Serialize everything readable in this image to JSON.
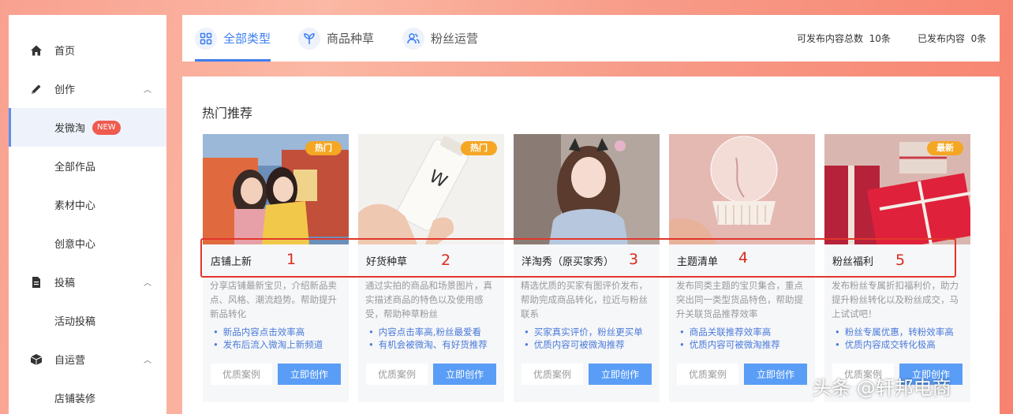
{
  "sidebar": {
    "items": [
      {
        "label": "首页",
        "icon": "home-icon"
      },
      {
        "label": "创作",
        "icon": "pencil-icon",
        "chevron": "up"
      },
      {
        "label": "发微淘",
        "badge": "NEW"
      },
      {
        "label": "全部作品"
      },
      {
        "label": "素材中心"
      },
      {
        "label": "创意中心"
      },
      {
        "label": "投稿",
        "icon": "document-icon",
        "chevron": "up"
      },
      {
        "label": "活动投稿"
      },
      {
        "label": "自运营",
        "icon": "box-icon",
        "chevron": "up"
      },
      {
        "label": "店铺装修"
      }
    ]
  },
  "tabs": [
    {
      "label": "全部类型",
      "icon": "grid-icon"
    },
    {
      "label": "商品种草",
      "icon": "sprout-icon"
    },
    {
      "label": "粉丝运营",
      "icon": "users-icon"
    }
  ],
  "stats": {
    "total_label": "可发布内容总数",
    "total_value": "10条",
    "published_label": "已发布内容",
    "published_value": "0条"
  },
  "section_title": "热门推荐",
  "cards": [
    {
      "tag": "热门",
      "name": "店铺上新",
      "desc": "分享店铺最新宝贝，介绍新品卖点、风格、潮流趋势。帮助提升新品转化",
      "bullets": [
        "新品内容点击效率高",
        "发布后流入微淘上新频道"
      ],
      "case": "优质案例",
      "create": "立即创作"
    },
    {
      "tag": "热门",
      "name": "好货种草",
      "desc": "通过实拍的商品和场景图片，真实描述商品的特色以及使用感受，帮助种草粉丝",
      "bullets": [
        "内容点击率高,粉丝最爱看",
        "有机会被微淘、有好货推荐"
      ],
      "case": "优质案例",
      "create": "立即创作"
    },
    {
      "tag": "",
      "name": "洋淘秀（原买家秀）",
      "desc": "精选优质的买家有图评价发布，帮助完成商品转化，拉近与粉丝联系",
      "bullets": [
        "买家真实评价，粉丝更买单",
        "优质内容可被微淘推荐"
      ],
      "case": "优质案例",
      "create": "立即创作"
    },
    {
      "tag": "",
      "name": "主题清单",
      "desc": "发布同类主题的宝贝集合，重点突出同一类型货品特色，帮助提升关联货品推荐效率",
      "bullets": [
        "商品关联推荐效率高",
        "优质内容可被微淘推荐"
      ],
      "case": "优质案例",
      "create": "立即创作"
    },
    {
      "tag": "最新",
      "name": "粉丝福利",
      "desc": "发布粉丝专属折扣福利价，助力提升粉丝转化以及粉丝成交，马上试试吧！",
      "bullets": [
        "粉丝专属优惠，转粉效率高",
        "优质内容成交转化极高"
      ],
      "case": "优质案例",
      "create": "立即创作"
    }
  ],
  "annotations": [
    "1",
    "2",
    "3",
    "4",
    "5"
  ],
  "watermark": "头条 @轩邦电商"
}
